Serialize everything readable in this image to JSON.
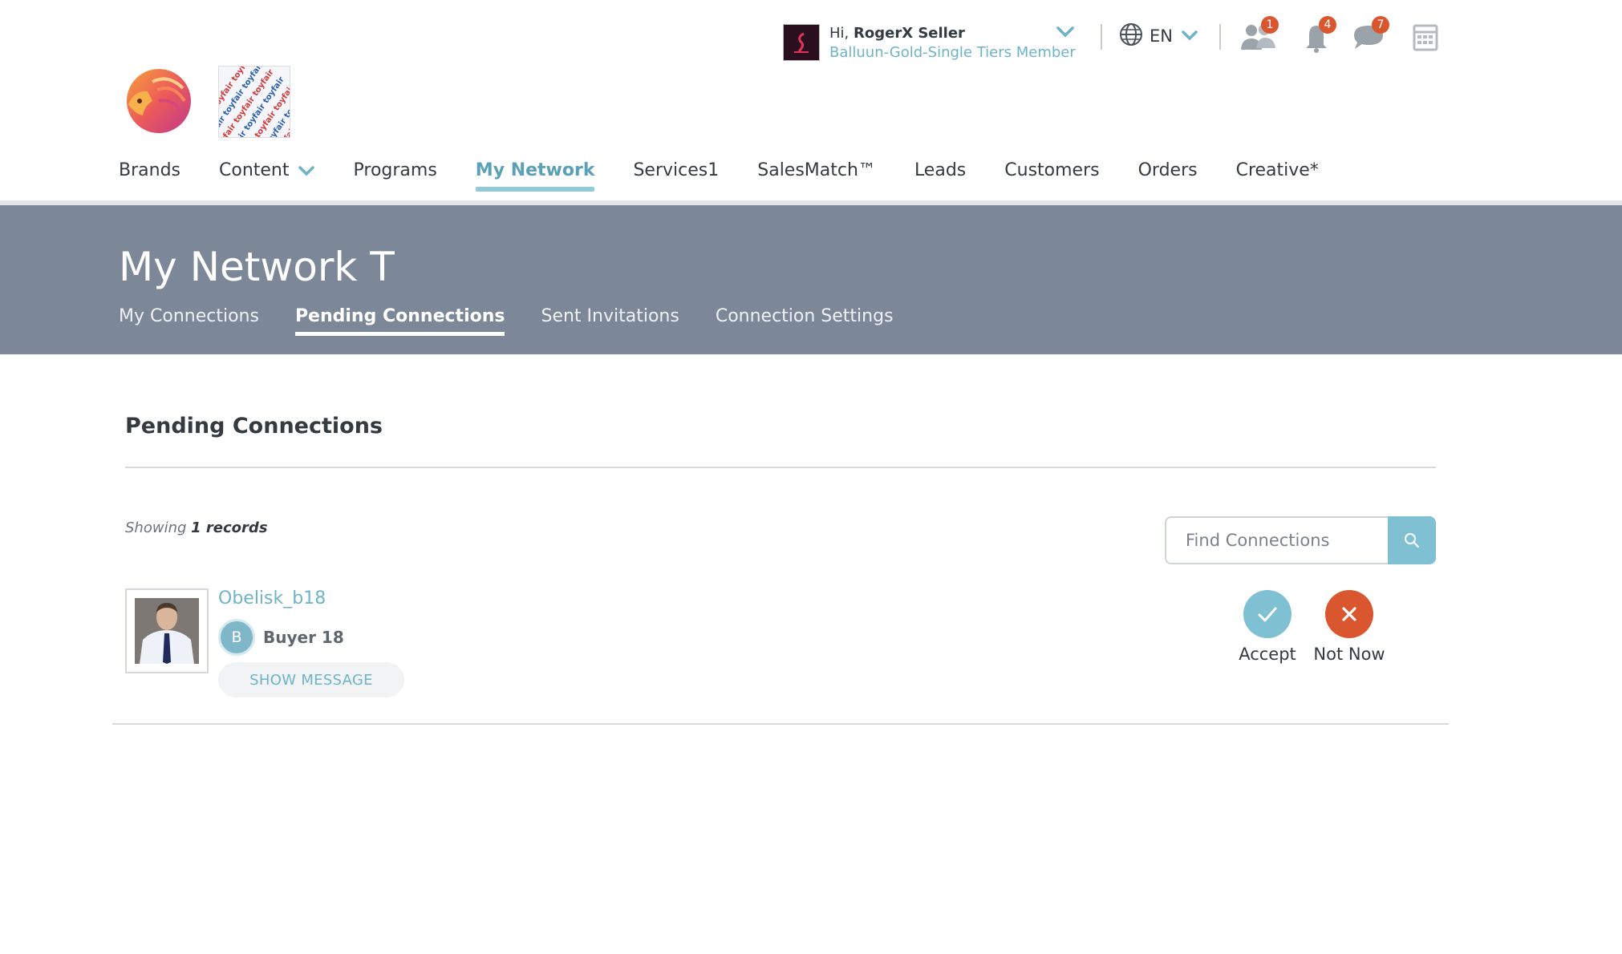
{
  "header": {
    "logo_name": "lion-logo",
    "brand_logo_name": "toyfair-logo",
    "user": {
      "greeting_prefix": "Hi,",
      "name": "RogerX Seller",
      "tier": "Balluun-Gold-Single Tiers Member"
    },
    "language": "EN",
    "icons": {
      "connections": {
        "name": "people-icon",
        "badge": "1"
      },
      "notifications": {
        "name": "bell-icon",
        "badge": "4"
      },
      "messages": {
        "name": "chat-icon",
        "badge": "7"
      },
      "calendar": {
        "name": "calendar-icon"
      }
    }
  },
  "nav": {
    "items": [
      {
        "label": "Brands"
      },
      {
        "label": "Content",
        "has_dropdown": true
      },
      {
        "label": "Programs"
      },
      {
        "label": "My Network",
        "active": true
      },
      {
        "label": "Services1"
      },
      {
        "label": "SalesMatch™"
      },
      {
        "label": "Leads"
      },
      {
        "label": "Customers"
      },
      {
        "label": "Orders"
      },
      {
        "label": "Creative*"
      }
    ]
  },
  "banner": {
    "title": "My Network T",
    "tabs": [
      {
        "label": "My Connections"
      },
      {
        "label": "Pending Connections",
        "active": true
      },
      {
        "label": "Sent Invitations"
      },
      {
        "label": "Connection Settings"
      }
    ]
  },
  "content": {
    "section_title": "Pending Connections",
    "records_prefix": "Showing",
    "records_count": "1 records",
    "search": {
      "placeholder": "Find Connections",
      "value": ""
    },
    "connections": [
      {
        "name": "Obelisk_b18",
        "company_initial": "B",
        "company": "Buyer 18",
        "show_message_label": "SHOW MESSAGE",
        "accept_label": "Accept",
        "decline_label": "Not Now"
      }
    ]
  },
  "colors": {
    "accent": "#6fb3c8",
    "banner": "#7c8898",
    "badge": "#d9562f",
    "accept": "#7fc1d3",
    "decline": "#d9562f"
  }
}
